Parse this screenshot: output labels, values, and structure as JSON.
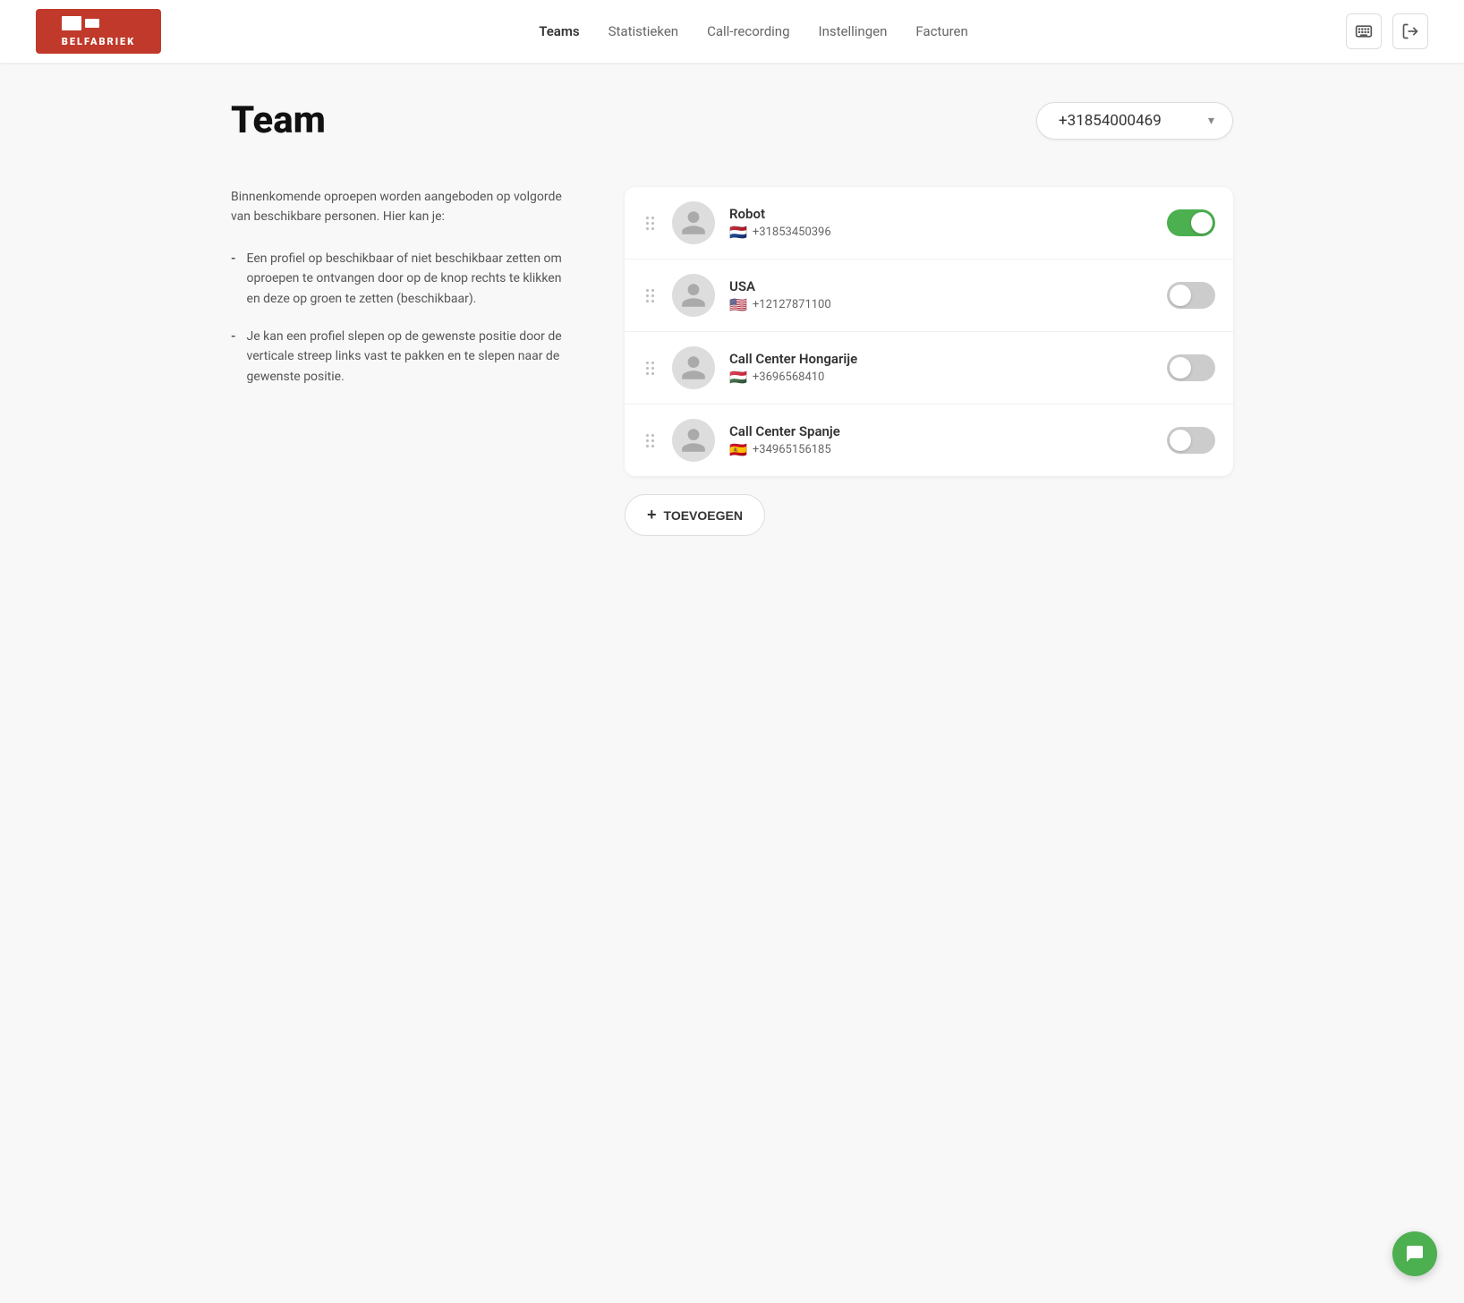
{
  "header": {
    "logo_alt": "Belfabriek",
    "nav": [
      {
        "label": "Teams",
        "href": "#",
        "active": true
      },
      {
        "label": "Statistieken",
        "href": "#",
        "active": false
      },
      {
        "label": "Call-recording",
        "href": "#",
        "active": false
      },
      {
        "label": "Instellingen",
        "href": "#",
        "active": false
      },
      {
        "label": "Facturen",
        "href": "#",
        "active": false
      }
    ],
    "icon_keyboard": "⌨",
    "icon_exit": "➜"
  },
  "page": {
    "title": "Team",
    "phone_number": "+31854000469"
  },
  "description": {
    "intro": "Binnenkomende oproepen worden aangeboden op volgorde van beschikbare personen. Hier kan je:",
    "bullets": [
      "Een profiel op beschikbaar of niet beschikbaar zetten om oproepen te ontvangen door op de knop rechts te klikken en deze op groen te zetten (beschikbaar).",
      "Je kan een profiel slepen op de gewenste positie door de verticale streep links vast te pakken en te slepen naar de gewenste positie."
    ]
  },
  "team_members": [
    {
      "name": "Robot",
      "phone": "+31853450396",
      "flag": "🇳🇱",
      "enabled": true
    },
    {
      "name": "USA",
      "phone": "+12127871100",
      "flag": "🇺🇸",
      "enabled": false
    },
    {
      "name": "Call Center Hongarije",
      "phone": "+3696568410",
      "flag": "🇭🇺",
      "enabled": false
    },
    {
      "name": "Call Center Spanje",
      "phone": "+34965156185",
      "flag": "🇪🇸",
      "enabled": false
    }
  ],
  "add_button_label": "TOEVOEGEN",
  "file_badge": "Ups_logo.png"
}
